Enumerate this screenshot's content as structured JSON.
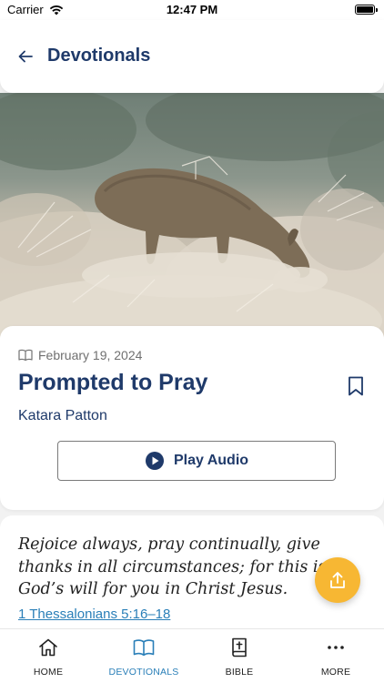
{
  "status_bar": {
    "carrier": "Carrier",
    "time": "12:47 PM"
  },
  "header": {
    "title": "Devotionals"
  },
  "devotional": {
    "date": "February 19, 2024",
    "title": "Prompted to Pray",
    "author": "Katara Patton",
    "play_audio_label": "Play Audio"
  },
  "scripture": {
    "text": "Rejoice always, pray continually, give thanks in all circumstances; for this is God’s will for you in Christ Jesus.",
    "reference": "1 Thessalonians 5:16–18"
  },
  "bottom_nav": {
    "items": [
      {
        "label": "HOME",
        "icon": "home-icon"
      },
      {
        "label": "DEVOTIONALS",
        "icon": "open-book-icon"
      },
      {
        "label": "BIBLE",
        "icon": "bible-icon"
      },
      {
        "label": "MORE",
        "icon": "more-dots-icon"
      }
    ]
  },
  "colors": {
    "primary_navy": "#1f3a6a",
    "accent_blue": "#2a7fb8",
    "fab_yellow": "#f7b733"
  }
}
